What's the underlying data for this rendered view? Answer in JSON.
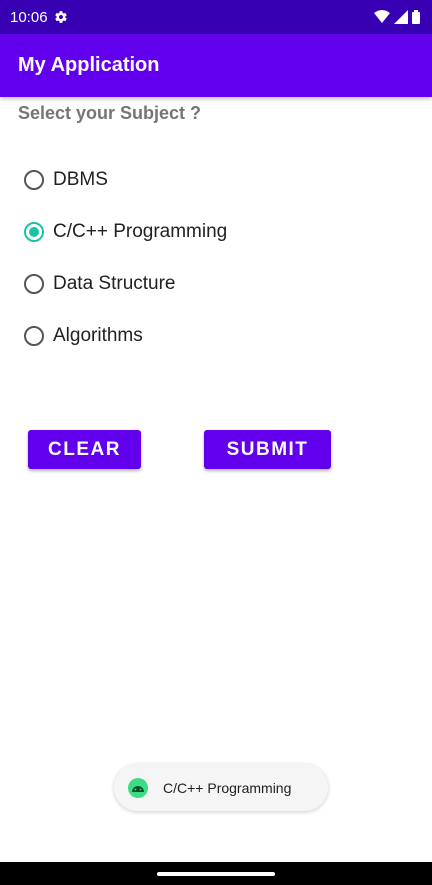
{
  "status_bar": {
    "time": "10:06",
    "icons": [
      "gear-icon",
      "wifi-icon",
      "signal-icon",
      "battery-icon"
    ]
  },
  "app_bar": {
    "title": "My Application",
    "color": "#6200EE",
    "status_color": "#3700B3"
  },
  "prompt": "Select your Subject ?",
  "radio_options": [
    {
      "label": "DBMS",
      "checked": false
    },
    {
      "label": "C/C++ Programming",
      "checked": true
    },
    {
      "label": "Data Structure",
      "checked": false
    },
    {
      "label": "Algorithms",
      "checked": false
    }
  ],
  "radio_accent_color": "#1DC1A6",
  "buttons": {
    "clear_label": "CLEAR",
    "submit_label": "SUBMIT"
  },
  "toast": {
    "icon": "android-icon",
    "text": "C/C++ Programming"
  }
}
